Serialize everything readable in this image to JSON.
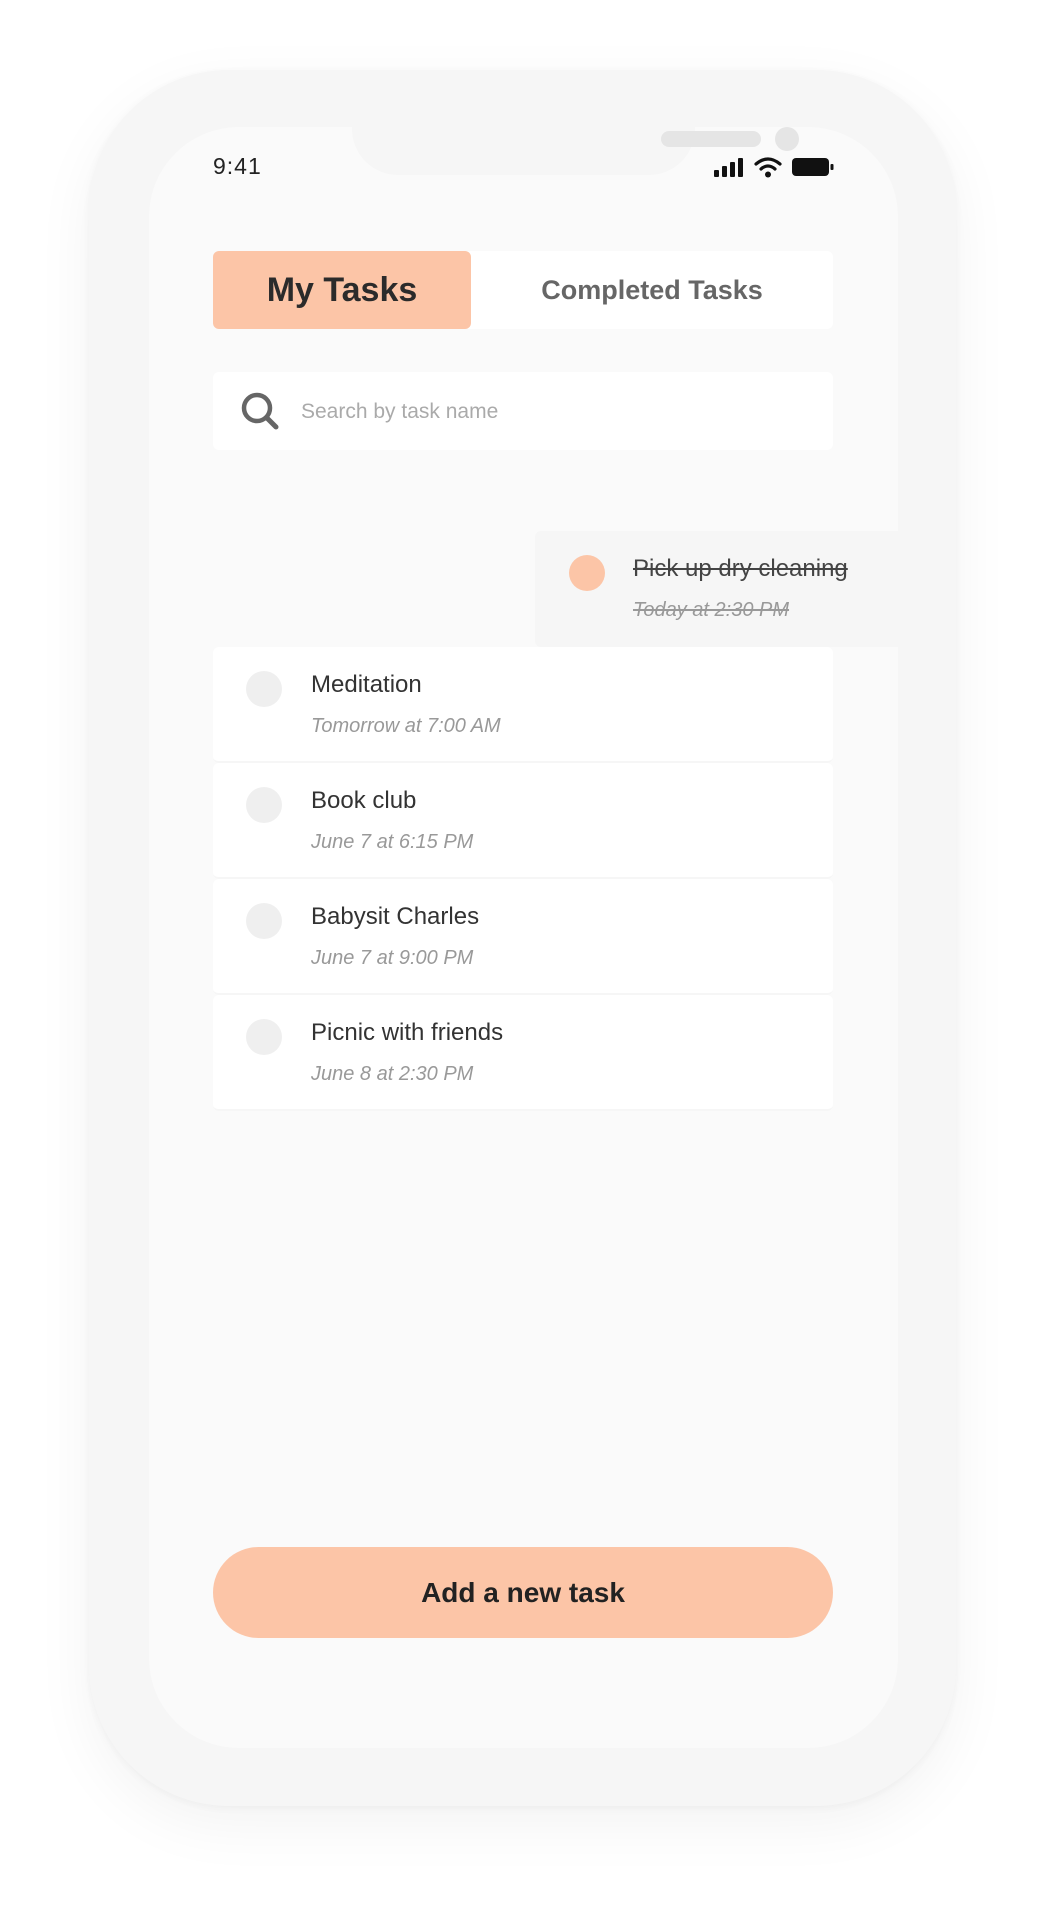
{
  "status_bar": {
    "time": "9:41",
    "icons": [
      "signal-icon",
      "wifi-icon",
      "battery-icon"
    ]
  },
  "tabs": {
    "active_label": "My Tasks",
    "inactive_label": "Completed Tasks"
  },
  "search": {
    "placeholder": "Search by task name",
    "value": ""
  },
  "swiped_task": {
    "title": "Pick up dry cleaning",
    "subtitle": "Today at 2:30 PM",
    "completed": true
  },
  "tasks": [
    {
      "title": "Meditation",
      "subtitle": "Tomorrow at 7:00 AM",
      "completed": false
    },
    {
      "title": "Book club",
      "subtitle": "June 7 at 6:15 PM",
      "completed": false
    },
    {
      "title": "Babysit Charles",
      "subtitle": "June 7 at 9:00 PM",
      "completed": false
    },
    {
      "title": "Picnic with friends",
      "subtitle": "June 8 at 2:30 PM",
      "completed": false
    }
  ],
  "add_button": {
    "label": "Add a new task"
  },
  "colors": {
    "accent": "#fcc5a7",
    "background": "#fafafa",
    "card": "#ffffff",
    "unchecked": "#efefef"
  }
}
